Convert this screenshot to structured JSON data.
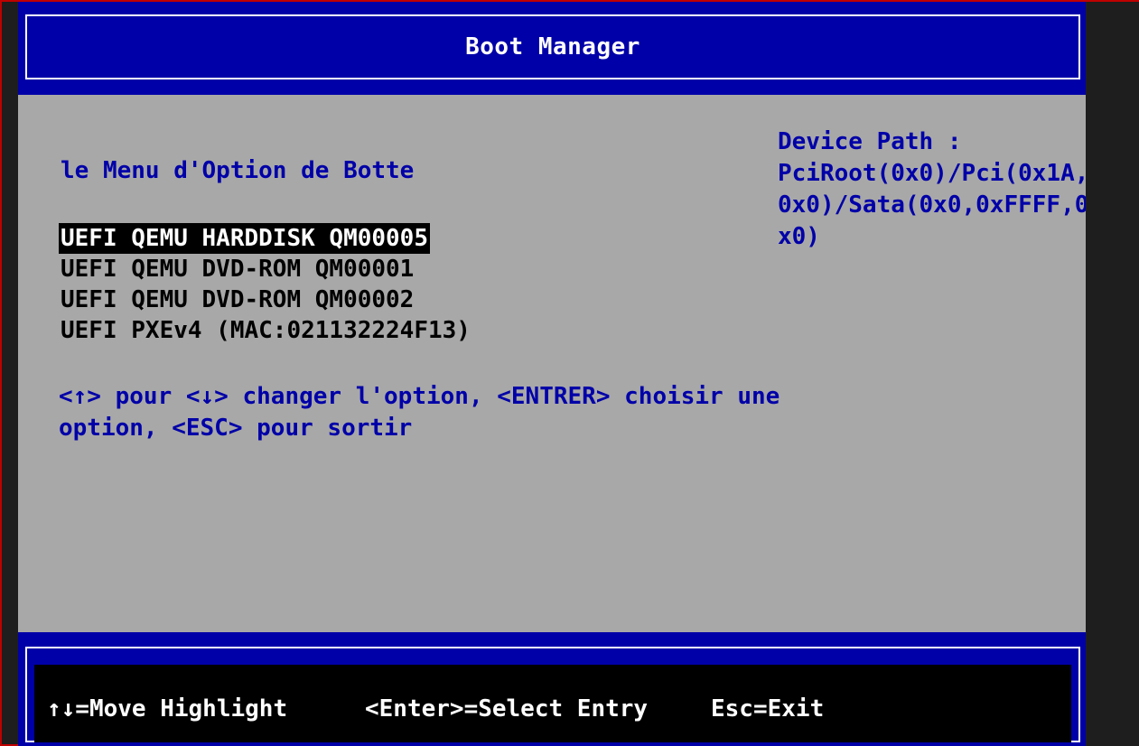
{
  "header": {
    "title": "Boot Manager"
  },
  "menu": {
    "heading": "le Menu d'Option de Botte",
    "options": [
      "UEFI QEMU HARDDISK QM00005",
      "UEFI QEMU DVD-ROM QM00001",
      "UEFI QEMU DVD-ROM QM00002",
      "UEFI PXEv4 (MAC:021132224F13)"
    ],
    "selected_index": 0,
    "help_line1": "<↑> pour <↓> changer l'option, <ENTRER> choisir une",
    "help_line2": "option, <ESC> pour sortir"
  },
  "device_path": {
    "lines": [
      "Device Path :",
      "PciRoot(0x0)/Pci(0x1A,",
      "0x0)/Sata(0x0,0xFFFF,0",
      "x0)"
    ]
  },
  "footer": {
    "move": "↑↓=Move Highlight",
    "enter": "<Enter>=Select Entry",
    "esc": "Esc=Exit"
  },
  "colors": {
    "background": "#a8a8a8",
    "bar": "#0000a8",
    "accent_text": "#0000a8",
    "highlight_bg": "#000000",
    "highlight_fg": "#ffffff",
    "window_border": "#c00000"
  }
}
